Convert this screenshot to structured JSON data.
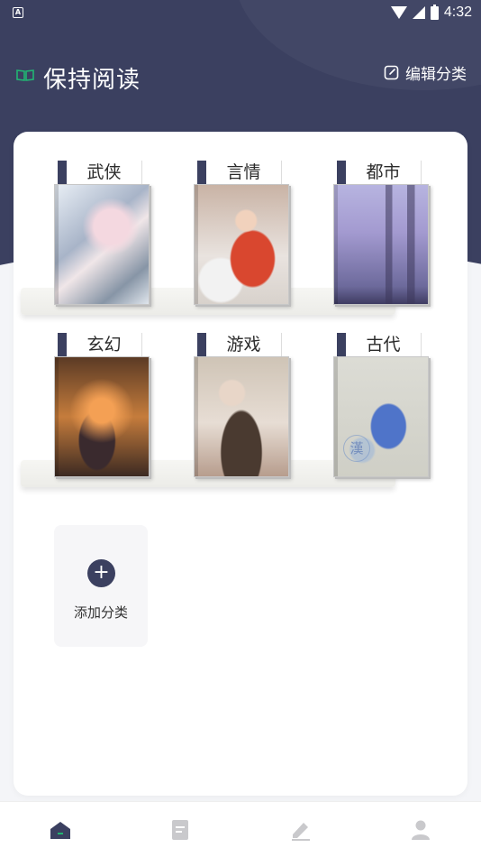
{
  "status_bar": {
    "app_badge": "A",
    "time": "4:32",
    "icons": [
      "wifi-icon",
      "signal-icon",
      "battery-icon"
    ]
  },
  "header": {
    "title": "保持阅读",
    "edit_label": "编辑分类",
    "icons": [
      "book-open-icon",
      "edit-icon"
    ]
  },
  "colors": {
    "brand": "#3b4060",
    "accent_green": "#22b573",
    "background": "#f4f5f8"
  },
  "categories": [
    {
      "label": "武侠",
      "cover": "wuxia-cover-art"
    },
    {
      "label": "言情",
      "cover": "romance-cover-art"
    },
    {
      "label": "都市",
      "cover": "city-skyline-cover-art"
    },
    {
      "label": "玄幻",
      "cover": "fantasy-cover-art"
    },
    {
      "label": "游戏",
      "cover": "game-cover-art"
    },
    {
      "label": "古代",
      "cover": "ancient-cover-art",
      "seal_text": "漢"
    }
  ],
  "add_category": {
    "label": "添加分类",
    "icon": "plus-icon"
  },
  "bottom_nav": {
    "items": [
      {
        "name": "home",
        "icon": "home-icon",
        "active": true
      },
      {
        "name": "library",
        "icon": "document-icon",
        "active": false
      },
      {
        "name": "write",
        "icon": "pen-icon",
        "active": false
      },
      {
        "name": "profile",
        "icon": "user-icon",
        "active": false
      }
    ]
  }
}
